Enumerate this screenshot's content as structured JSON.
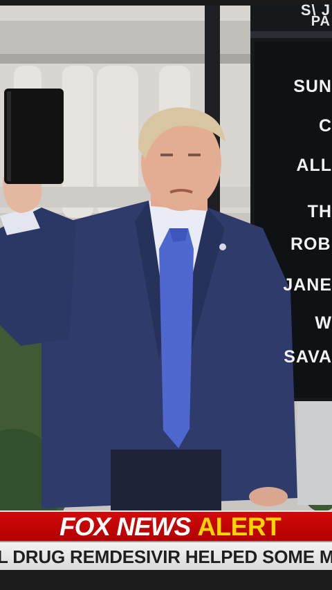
{
  "sign": {
    "top_line_1": "S\\ J",
    "top_line_2": "PA",
    "lines": [
      "SUN",
      "C",
      "ALL",
      "TH",
      "ROB",
      "JANE",
      "W",
      "SAVA"
    ]
  },
  "ticker": {
    "network": "FOX NEWS",
    "alert_word": "ALERT",
    "crawl": "L DRUG REMDESIVIR HELPED SOME MO"
  },
  "colors": {
    "alert_red": "#c40505",
    "alert_yellow": "#ffd400",
    "suit": "#2f3b6b",
    "tie": "#4f68cf"
  }
}
